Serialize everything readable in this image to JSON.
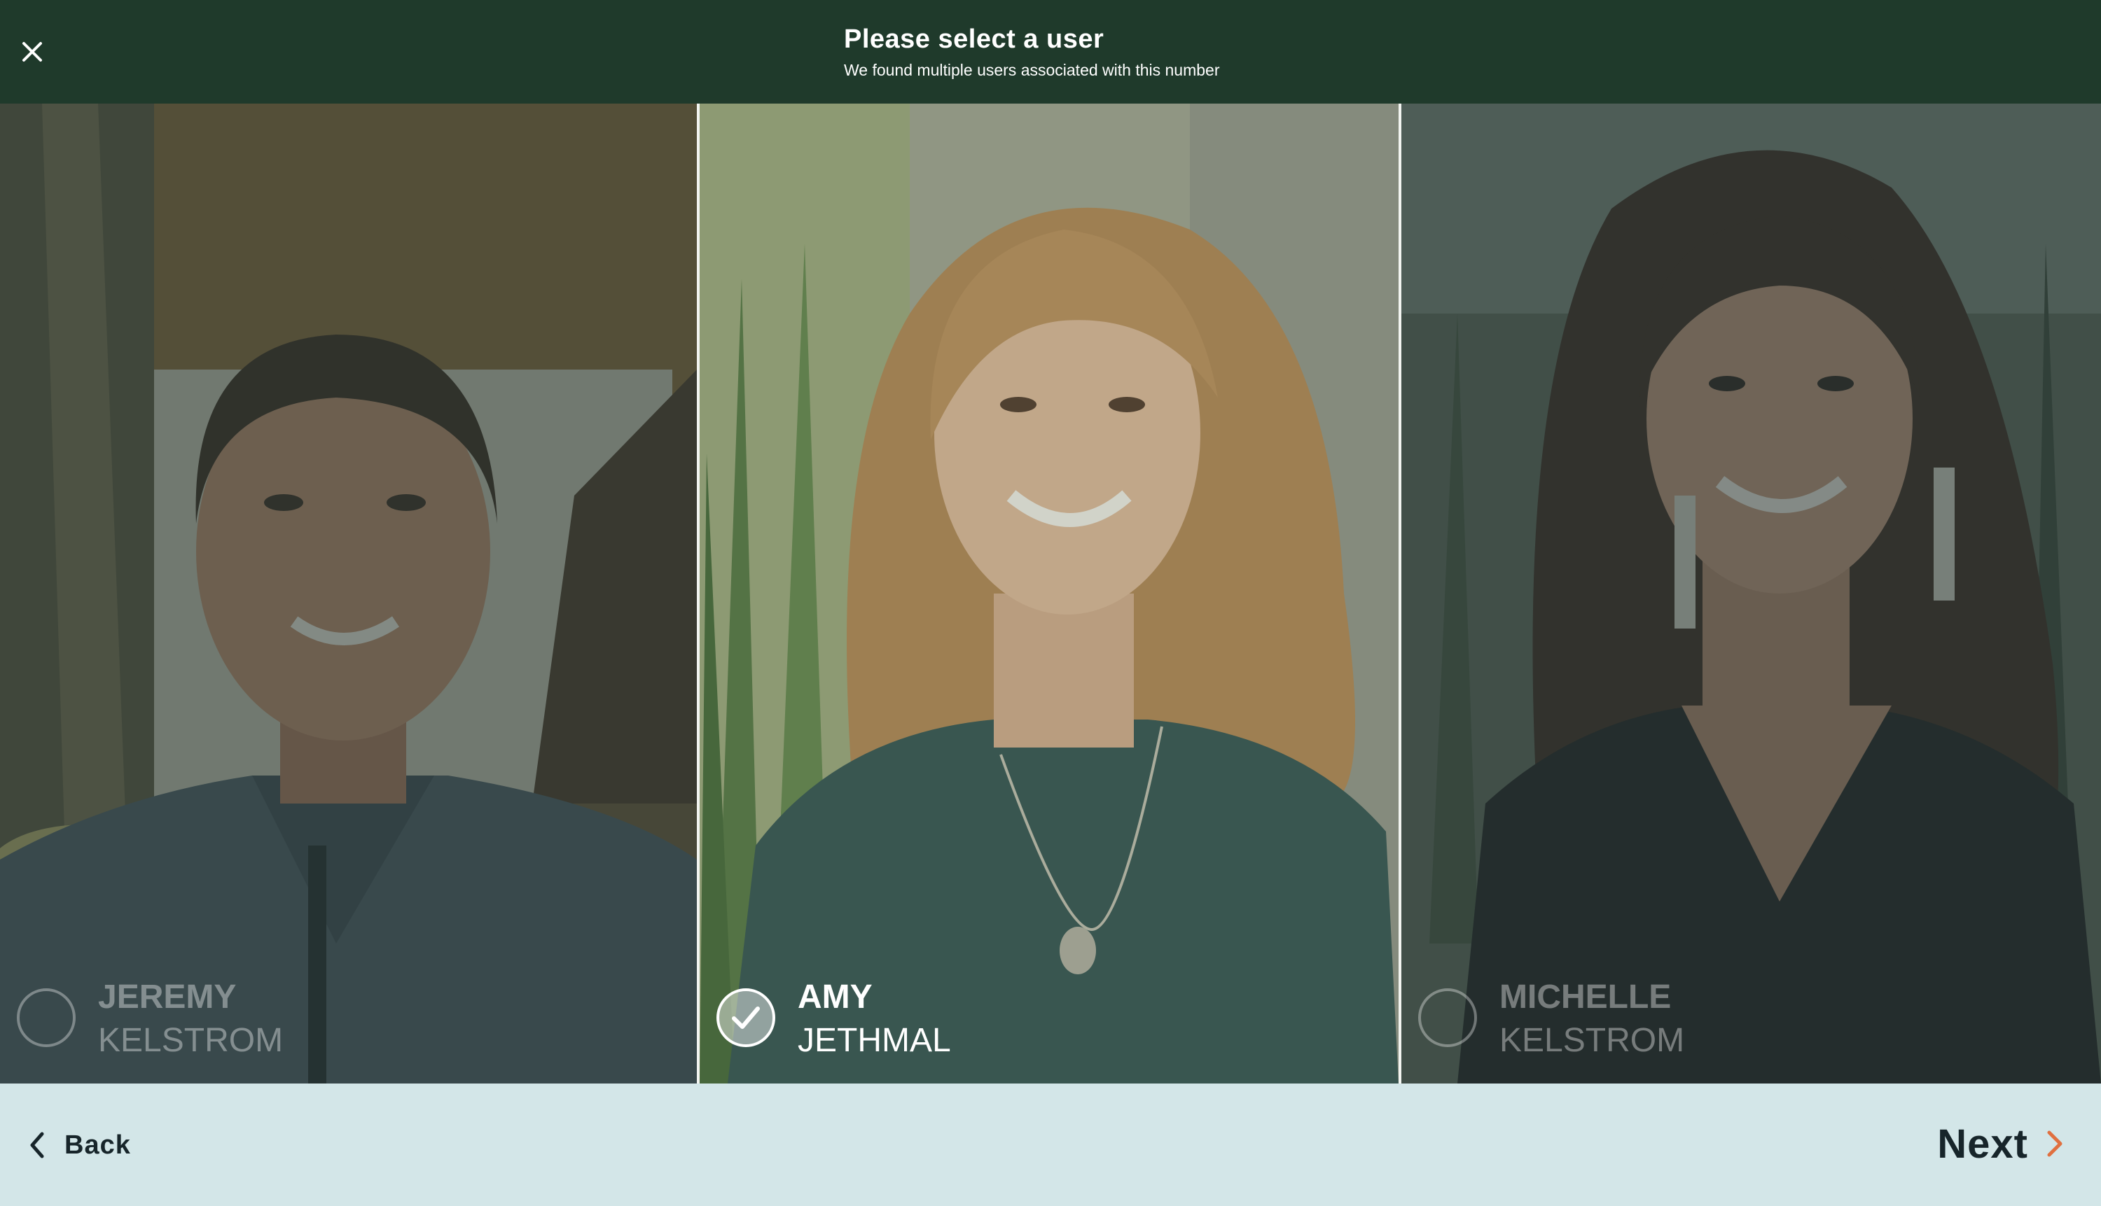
{
  "header": {
    "title": "Please select a user",
    "subtitle": "We found multiple users associated with this number"
  },
  "users": [
    {
      "first": "JEREMY",
      "last": "KELSTROM",
      "selected": false
    },
    {
      "first": "AMY",
      "last": "JETHMAL",
      "selected": true
    },
    {
      "first": "MICHELLE",
      "last": "KELSTROM",
      "selected": false
    }
  ],
  "footer": {
    "back_label": "Back",
    "next_label": "Next"
  },
  "colors": {
    "header_bg": "#1f3a2b",
    "footer_bg": "#d3e6e8",
    "next_arrow": "#e0703f",
    "text_dark": "#17252a"
  },
  "icons": {
    "close": "close-icon",
    "back": "chevron-left-icon",
    "next": "chevron-right-icon",
    "check": "check-icon"
  }
}
